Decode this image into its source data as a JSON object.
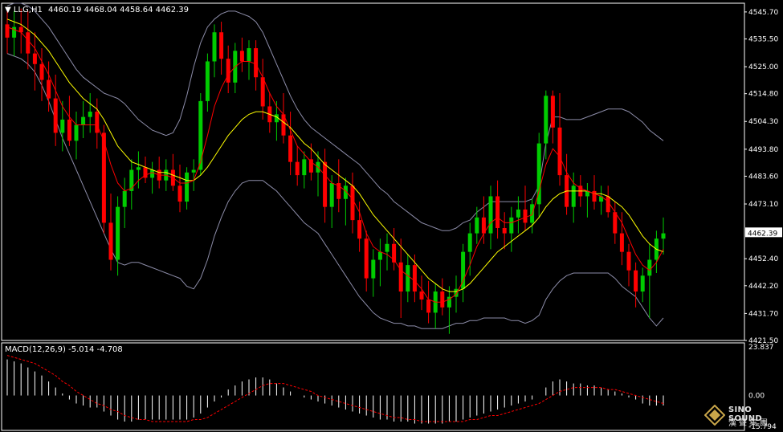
{
  "header": {
    "symbol": "LLG,H1",
    "ohlc": "4460.19 4468.04 4458.64 4462.39"
  },
  "macd": {
    "label": "MACD(12,26,9) -5.014 -4.708",
    "axis_labels": [
      "23.837",
      "0.00",
      "-15.794"
    ],
    "range": [
      -15.794,
      23.837
    ]
  },
  "price_axis": {
    "ticks": [
      "4545.70",
      "4535.50",
      "4525.00",
      "4514.80",
      "4504.30",
      "4493.80",
      "4483.60",
      "4473.10",
      "4462.39",
      "4452.40",
      "4442.20",
      "4431.70",
      "4421.50"
    ],
    "current": "4462.39"
  },
  "colors": {
    "background": "#000000",
    "bull": "#00cc00",
    "bear": "#ff0000",
    "ma_fast": "#ff0000",
    "ma_slow": "#ffff00",
    "bollinger": "#8c8ca8",
    "macd_hist": "#ffffff",
    "macd_signal": "#ff0000",
    "grid_frame": "#ffffff"
  },
  "logo": {
    "name": "SINO SOUND",
    "sub": "漢聲集團"
  },
  "chart_data": [
    {
      "type": "candlestick",
      "title": "LLG,H1",
      "ylim": [
        4421.5,
        4549.0
      ],
      "candles": [
        [
          4541,
          4547,
          4530,
          4536
        ],
        [
          4536,
          4546,
          4529,
          4540
        ],
        [
          4540,
          4547,
          4530,
          4538
        ],
        [
          4538,
          4546,
          4524,
          4530
        ],
        [
          4530,
          4538,
          4516,
          4526
        ],
        [
          4526,
          4532,
          4512,
          4520
        ],
        [
          4520,
          4527,
          4508,
          4513
        ],
        [
          4513,
          4522,
          4495,
          4500
        ],
        [
          4500,
          4512,
          4493,
          4505
        ],
        [
          4505,
          4514,
          4495,
          4497
        ],
        [
          4497,
          4508,
          4490,
          4503
        ],
        [
          4503,
          4512,
          4498,
          4506
        ],
        [
          4506,
          4515,
          4500,
          4508
        ],
        [
          4508,
          4513,
          4494,
          4500
        ],
        [
          4500,
          4503,
          4462,
          4466
        ],
        [
          4466,
          4477,
          4448,
          4452
        ],
        [
          4452,
          4476,
          4446,
          4472
        ],
        [
          4472,
          4483,
          4464,
          4478
        ],
        [
          4478,
          4490,
          4471,
          4486
        ],
        [
          4486,
          4493,
          4479,
          4487
        ],
        [
          4487,
          4491,
          4481,
          4483
        ],
        [
          4483,
          4489,
          4477,
          4486
        ],
        [
          4486,
          4491,
          4479,
          4482
        ],
        [
          4482,
          4490,
          4478,
          4486
        ],
        [
          4486,
          4492,
          4478,
          4480
        ],
        [
          4480,
          4488,
          4470,
          4474
        ],
        [
          4474,
          4487,
          4471,
          4485
        ],
        [
          4485,
          4490,
          4478,
          4486
        ],
        [
          4486,
          4515,
          4484,
          4512
        ],
        [
          4512,
          4530,
          4508,
          4527
        ],
        [
          4527,
          4541,
          4521,
          4538
        ],
        [
          4538,
          4542,
          4522,
          4528
        ],
        [
          4528,
          4533,
          4515,
          4519
        ],
        [
          4519,
          4534,
          4515,
          4531
        ],
        [
          4531,
          4536,
          4523,
          4527
        ],
        [
          4527,
          4535,
          4520,
          4532
        ],
        [
          4532,
          4535,
          4516,
          4521
        ],
        [
          4521,
          4528,
          4505,
          4510
        ],
        [
          4510,
          4515,
          4500,
          4504
        ],
        [
          4504,
          4512,
          4497,
          4507
        ],
        [
          4507,
          4515,
          4496,
          4499
        ],
        [
          4499,
          4508,
          4484,
          4489
        ],
        [
          4489,
          4495,
          4480,
          4484
        ],
        [
          4484,
          4493,
          4479,
          4490
        ],
        [
          4490,
          4496,
          4482,
          4485
        ],
        [
          4485,
          4493,
          4476,
          4489
        ],
        [
          4489,
          4494,
          4466,
          4472
        ],
        [
          4472,
          4484,
          4464,
          4481
        ],
        [
          4481,
          4490,
          4470,
          4475
        ],
        [
          4475,
          4483,
          4465,
          4480
        ],
        [
          4480,
          4485,
          4462,
          4467
        ],
        [
          4467,
          4474,
          4455,
          4460
        ],
        [
          4460,
          4463,
          4440,
          4445
        ],
        [
          4445,
          4456,
          4438,
          4452
        ],
        [
          4452,
          4460,
          4442,
          4455
        ],
        [
          4455,
          4462,
          4448,
          4458
        ],
        [
          4458,
          4464,
          4448,
          4451
        ],
        [
          4451,
          4460,
          4430,
          4440
        ],
        [
          4440,
          4454,
          4436,
          4450
        ],
        [
          4450,
          4454,
          4436,
          4440
        ],
        [
          4440,
          4446,
          4433,
          4437
        ],
        [
          4437,
          4444,
          4428,
          4432
        ],
        [
          4432,
          4443,
          4426,
          4440
        ],
        [
          4440,
          4445,
          4431,
          4434
        ],
        [
          4434,
          4442,
          4424,
          4438
        ],
        [
          4438,
          4446,
          4432,
          4441
        ],
        [
          4441,
          4458,
          4436,
          4455
        ],
        [
          4455,
          4466,
          4446,
          4462
        ],
        [
          4462,
          4472,
          4458,
          4468
        ],
        [
          4468,
          4476,
          4458,
          4462
        ],
        [
          4462,
          4480,
          4456,
          4476
        ],
        [
          4476,
          4482,
          4460,
          4464
        ],
        [
          4464,
          4470,
          4456,
          4462
        ],
        [
          4462,
          4472,
          4455,
          4468
        ],
        [
          4468,
          4476,
          4462,
          4471
        ],
        [
          4471,
          4480,
          4463,
          4466
        ],
        [
          4466,
          4475,
          4462,
          4473
        ],
        [
          4473,
          4500,
          4468,
          4496
        ],
        [
          4496,
          4516,
          4490,
          4514
        ],
        [
          4514,
          4516,
          4496,
          4502
        ],
        [
          4502,
          4515,
          4480,
          4484
        ],
        [
          4484,
          4492,
          4469,
          4472
        ],
        [
          4472,
          4485,
          4466,
          4480
        ],
        [
          4480,
          4484,
          4472,
          4476
        ],
        [
          4476,
          4481,
          4468,
          4478
        ],
        [
          4478,
          4484,
          4471,
          4474
        ],
        [
          4474,
          4480,
          4469,
          4476
        ],
        [
          4476,
          4480,
          4468,
          4470
        ],
        [
          4470,
          4474,
          4458,
          4462
        ],
        [
          4462,
          4470,
          4450,
          4455
        ],
        [
          4455,
          4458,
          4442,
          4448
        ],
        [
          4448,
          4451,
          4434,
          4440
        ],
        [
          4440,
          4449,
          4436,
          4446
        ],
        [
          4446,
          4458,
          4430,
          4452
        ],
        [
          4452,
          4463,
          4447,
          4460
        ],
        [
          4460,
          4468,
          4454,
          4462
        ]
      ],
      "ma_fast": [
        4540,
        4539,
        4538,
        4535,
        4532,
        4527,
        4522,
        4516,
        4510,
        4506,
        4503,
        4503,
        4503,
        4503,
        4497,
        4488,
        4481,
        4478,
        4479,
        4482,
        4484,
        4485,
        4484,
        4484,
        4483,
        4481,
        4481,
        4482,
        4489,
        4499,
        4510,
        4517,
        4522,
        4525,
        4527,
        4527,
        4526,
        4521,
        4515,
        4510,
        4507,
        4501,
        4495,
        4492,
        4489,
        4487,
        4484,
        4481,
        4480,
        4478,
        4475,
        4470,
        4462,
        4457,
        4455,
        4454,
        4452,
        4448,
        4446,
        4444,
        4441,
        4437,
        4436,
        4436,
        4437,
        4439,
        4444,
        4450,
        4457,
        4462,
        4466,
        4468,
        4466,
        4466,
        4467,
        4468,
        4469,
        4478,
        4488,
        4494,
        4491,
        4485,
        4481,
        4479,
        4478,
        4477,
        4476,
        4474,
        4470,
        4466,
        4460,
        4454,
        4450,
        4448,
        4451,
        4456
      ],
      "ma_slow": [
        4543,
        4542,
        4541,
        4539,
        4537,
        4534,
        4531,
        4527,
        4523,
        4519,
        4516,
        4513,
        4511,
        4509,
        4505,
        4500,
        4495,
        4492,
        4489,
        4488,
        4487,
        4486,
        4485,
        4485,
        4484,
        4483,
        4482,
        4482,
        4484,
        4487,
        4491,
        4495,
        4499,
        4502,
        4505,
        4507,
        4508,
        4508,
        4507,
        4506,
        4504,
        4502,
        4499,
        4496,
        4494,
        4491,
        4488,
        4486,
        4484,
        4482,
        4480,
        4477,
        4473,
        4469,
        4466,
        4463,
        4460,
        4457,
        4454,
        4451,
        4448,
        4445,
        4443,
        4441,
        4440,
        4440,
        4441,
        4443,
        4446,
        4449,
        4452,
        4455,
        4457,
        4459,
        4461,
        4463,
        4465,
        4468,
        4472,
        4475,
        4477,
        4478,
        4478,
        4478,
        4478,
        4477,
        4477,
        4476,
        4474,
        4472,
        4469,
        4465,
        4461,
        4458,
        4456,
        4455
      ],
      "boll_upper": [
        4548,
        4549,
        4549,
        4548,
        4546,
        4543,
        4540,
        4536,
        4532,
        4528,
        4524,
        4521,
        4519,
        4517,
        4515,
        4514,
        4513,
        4511,
        4508,
        4505,
        4503,
        4501,
        4500,
        4499,
        4500,
        4505,
        4514,
        4525,
        4534,
        4540,
        4543,
        4545,
        4546,
        4546,
        4545,
        4544,
        4542,
        4538,
        4532,
        4526,
        4520,
        4514,
        4509,
        4505,
        4502,
        4500,
        4498,
        4496,
        4494,
        4492,
        4490,
        4488,
        4485,
        4482,
        4479,
        4477,
        4474,
        4472,
        4470,
        4468,
        4466,
        4465,
        4464,
        4463,
        4463,
        4464,
        4466,
        4467,
        4470,
        4472,
        4474,
        4474,
        4474,
        4474,
        4474,
        4474,
        4475,
        4480,
        4496,
        4506,
        4506,
        4505,
        4505,
        4505,
        4506,
        4507,
        4508,
        4509,
        4509,
        4509,
        4508,
        4506,
        4504,
        4501,
        4499,
        4497
      ],
      "boll_lower": [
        4530,
        4529,
        4528,
        4526,
        4523,
        4518,
        4512,
        4505,
        4498,
        4492,
        4486,
        4480,
        4474,
        4468,
        4462,
        4456,
        4451,
        4450,
        4451,
        4451,
        4450,
        4449,
        4448,
        4447,
        4446,
        4445,
        4442,
        4441,
        4445,
        4452,
        4461,
        4468,
        4474,
        4478,
        4481,
        4482,
        4482,
        4482,
        4480,
        4478,
        4475,
        4472,
        4469,
        4466,
        4464,
        4462,
        4458,
        4454,
        4450,
        4446,
        4442,
        4438,
        4435,
        4432,
        4430,
        4429,
        4428,
        4428,
        4427,
        4427,
        4426,
        4426,
        4426,
        4426,
        4427,
        4428,
        4428,
        4429,
        4429,
        4430,
        4430,
        4430,
        4430,
        4429,
        4429,
        4428,
        4429,
        4431,
        4437,
        4441,
        4444,
        4446,
        4447,
        4447,
        4447,
        4447,
        4447,
        4447,
        4445,
        4442,
        4440,
        4438,
        4434,
        4430,
        4427,
        4430
      ]
    },
    {
      "type": "bar",
      "title": "MACD(12,26,9) -5.014 -4.708",
      "ylim": [
        -15.794,
        23.837
      ],
      "macd_hist": [
        18,
        17,
        16,
        14,
        12,
        10,
        7,
        4,
        1,
        -2,
        -4,
        -5,
        -6,
        -6,
        -8,
        -10,
        -12,
        -13,
        -13,
        -12,
        -12,
        -12,
        -12,
        -12,
        -12,
        -12,
        -12,
        -11,
        -9,
        -6,
        -3,
        -1,
        3,
        5,
        7,
        8,
        9,
        9,
        8,
        6,
        4,
        2,
        0,
        -1,
        -2,
        -3,
        -4,
        -5,
        -6,
        -7,
        -8,
        -9,
        -10,
        -11,
        -12,
        -12,
        -13,
        -13,
        -13,
        -14,
        -14,
        -14,
        -14,
        -14,
        -13,
        -13,
        -12,
        -11,
        -10,
        -9,
        -8,
        -7,
        -6,
        -5,
        -4,
        -3,
        -2,
        0,
        4,
        7,
        8,
        7,
        6,
        6,
        5,
        5,
        4,
        3,
        2,
        1,
        -1,
        -2,
        -4,
        -5,
        -5,
        -5
      ],
      "macd_signal": [
        20,
        19,
        18,
        17,
        16,
        14,
        12,
        10,
        7,
        5,
        2,
        0,
        -2,
        -4,
        -5,
        -7,
        -8,
        -10,
        -11,
        -12,
        -12,
        -13,
        -13,
        -13,
        -13,
        -13,
        -13,
        -12,
        -12,
        -11,
        -9,
        -7,
        -5,
        -3,
        -1,
        1,
        3,
        5,
        6,
        6,
        6,
        5,
        4,
        3,
        2,
        0,
        -1,
        -2,
        -3,
        -4,
        -5,
        -6,
        -7,
        -8,
        -9,
        -10,
        -11,
        -11,
        -12,
        -12,
        -13,
        -13,
        -13,
        -13,
        -13,
        -13,
        -13,
        -12,
        -12,
        -11,
        -10,
        -10,
        -9,
        -8,
        -7,
        -6,
        -5,
        -4,
        -2,
        0,
        2,
        3,
        4,
        4,
        4,
        4,
        4,
        3,
        3,
        2,
        1,
        0,
        -1,
        -2,
        -3,
        -4
      ]
    }
  ]
}
